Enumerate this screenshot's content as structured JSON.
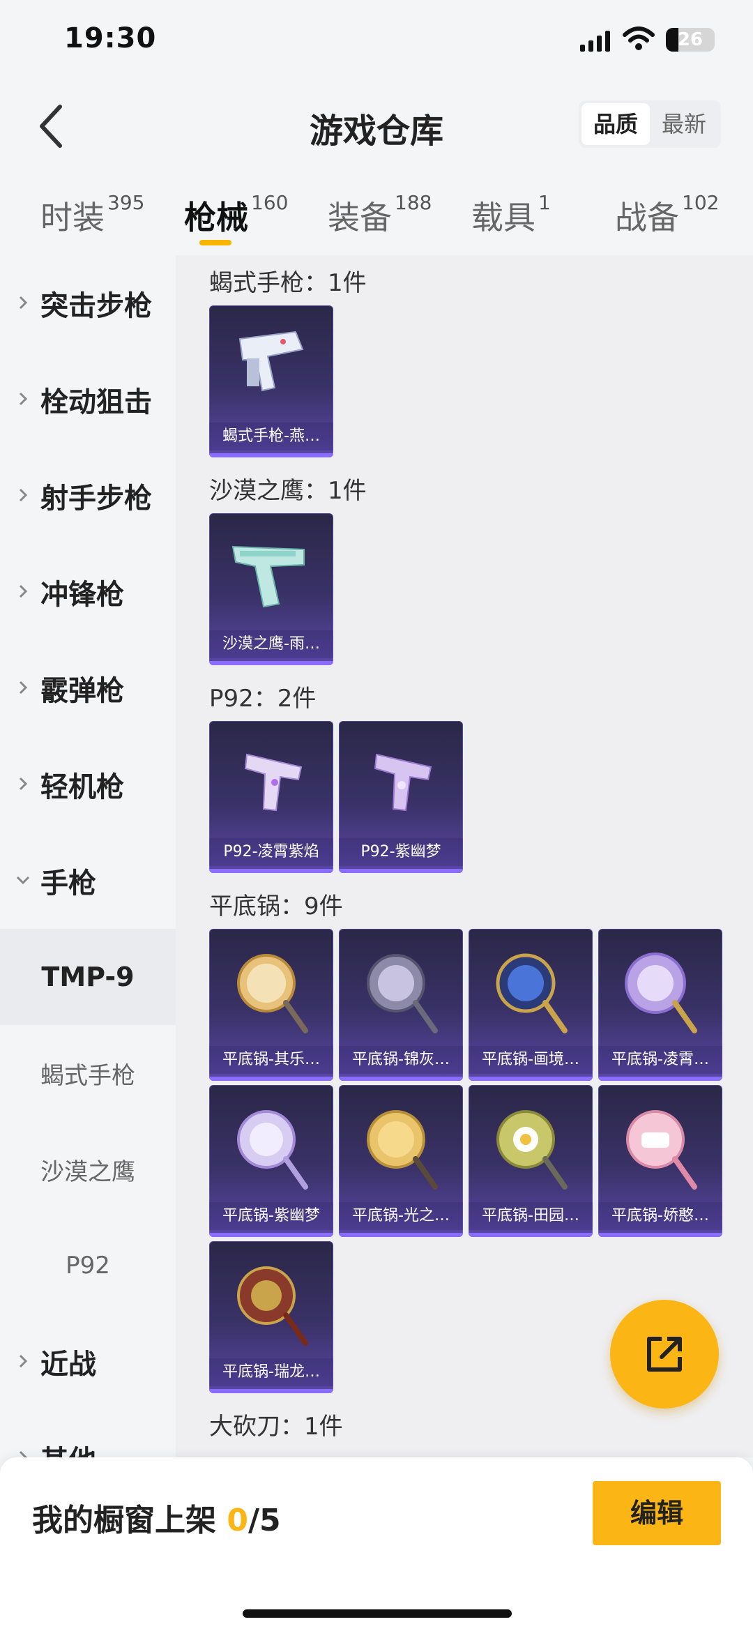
{
  "status": {
    "time": "19:30",
    "battery": "26",
    "battery_level": 0.26
  },
  "header": {
    "title": "游戏仓库",
    "sort_options": [
      "品质",
      "最新"
    ],
    "sort_active": "品质"
  },
  "tabs": [
    {
      "label": "时装",
      "count": "395"
    },
    {
      "label": "枪械",
      "count": "160"
    },
    {
      "label": "装备",
      "count": "188"
    },
    {
      "label": "载具",
      "count": "1"
    },
    {
      "label": "战备",
      "count": "102"
    }
  ],
  "active_tab": "枪械",
  "sidebar": {
    "categories_top": [
      "突击步枪",
      "栓动狙击",
      "射手步枪",
      "冲锋枪",
      "霰弹枪",
      "轻机枪",
      "手枪"
    ],
    "expanded": "手枪",
    "subitems": [
      "TMP-9",
      "蝎式手枪",
      "沙漠之鹰",
      "P92"
    ],
    "active_sub": "TMP-9",
    "categories_bottom": [
      "近战",
      "其他"
    ]
  },
  "groups": [
    {
      "title": "蝎式手枪：1件",
      "items": [
        "蝎式手枪-燕…"
      ]
    },
    {
      "title": "沙漠之鹰：1件",
      "items": [
        "沙漠之鹰-雨…"
      ]
    },
    {
      "title": "P92：2件",
      "items": [
        "P92-凌霄紫焰",
        "P92-紫幽梦"
      ]
    },
    {
      "title": "平底锅：9件",
      "items": [
        "平底锅-其乐…",
        "平底锅-锦灰…",
        "平底锅-画境…",
        "平底锅-凌霄…",
        "平底锅-紫幽梦",
        "平底锅-光之…",
        "平底锅-田园…",
        "平底锅-娇憨…",
        "平底锅-瑞龙…"
      ]
    },
    {
      "title": "大砍刀：1件",
      "items": []
    }
  ],
  "showcase": {
    "label": "我的橱窗上架 ",
    "count": "0",
    "total": "/5"
  },
  "edit_label": "编辑",
  "colors": {
    "accent": "#fbb515",
    "card_purple": "#5b48a8"
  }
}
